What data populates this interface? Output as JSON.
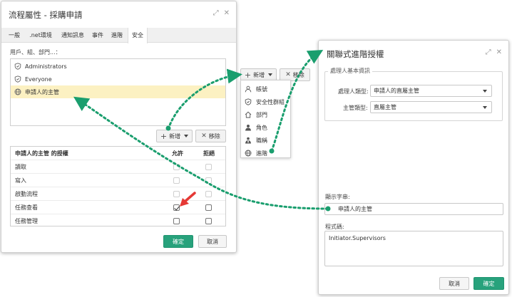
{
  "left_dialog": {
    "title": "流程屬性 - 採購申請",
    "tabs": [
      {
        "label": "一般"
      },
      {
        "label": ".net環境"
      },
      {
        "label": "通知訊息"
      },
      {
        "label": "事件"
      },
      {
        "label": "進階"
      },
      {
        "label": "安全"
      }
    ],
    "active_tab": "安全",
    "users_label": "用戶、組、部門...：",
    "users": [
      {
        "name": "Administrators",
        "icon": "shield-icon",
        "selected": false
      },
      {
        "name": "Everyone",
        "icon": "shield-icon",
        "selected": false
      },
      {
        "name": "申請人的主管",
        "icon": "globe-icon",
        "selected": true
      }
    ],
    "add_label": "新增",
    "remove_label": "移除",
    "perm_header": {
      "name": "申請人的主管 的授權",
      "allow": "允許",
      "deny": "拒絕"
    },
    "permissions": [
      {
        "name": "讀取",
        "allow": false,
        "deny": false,
        "disabled": true
      },
      {
        "name": "寫入",
        "allow": false,
        "deny": false,
        "disabled": true
      },
      {
        "name": "啟動流程",
        "allow": false,
        "deny": false,
        "disabled": true
      },
      {
        "name": "任務查看",
        "allow": true,
        "deny": false,
        "disabled": false
      },
      {
        "name": "任務管理",
        "allow": false,
        "deny": false,
        "disabled": false
      }
    ],
    "ok_label": "確定",
    "cancel_label": "取消"
  },
  "middle_menu": {
    "add_label": "新增",
    "remove_label": "移除",
    "items": [
      {
        "label": "帳號",
        "icon": "person-icon"
      },
      {
        "label": "安全性群組",
        "icon": "shield-icon"
      },
      {
        "label": "部門",
        "icon": "home-icon"
      },
      {
        "label": "角色",
        "icon": "role-icon"
      },
      {
        "label": "職稱",
        "icon": "title-icon"
      },
      {
        "label": "進階",
        "icon": "globe-icon"
      }
    ]
  },
  "right_dialog": {
    "title": "關聯式進階授權",
    "section_label": "處理人基本資訊",
    "handler_type_label": "處理人類型:",
    "handler_type_value": "申請人的直屬主管",
    "manager_type_label": "主管類型:",
    "manager_type_value": "直屬主管",
    "display_label": "顯示字串:",
    "display_value": "申請人的主管",
    "code_label": "程式碼:",
    "code_value": "Initiator.Supervisors",
    "cancel_label": "取消",
    "ok_label": "確定"
  },
  "colors": {
    "accent": "#28a27c",
    "selected_row": "#fcf1c2",
    "connector": "#1a9e6e",
    "pointer": "#e53935"
  }
}
